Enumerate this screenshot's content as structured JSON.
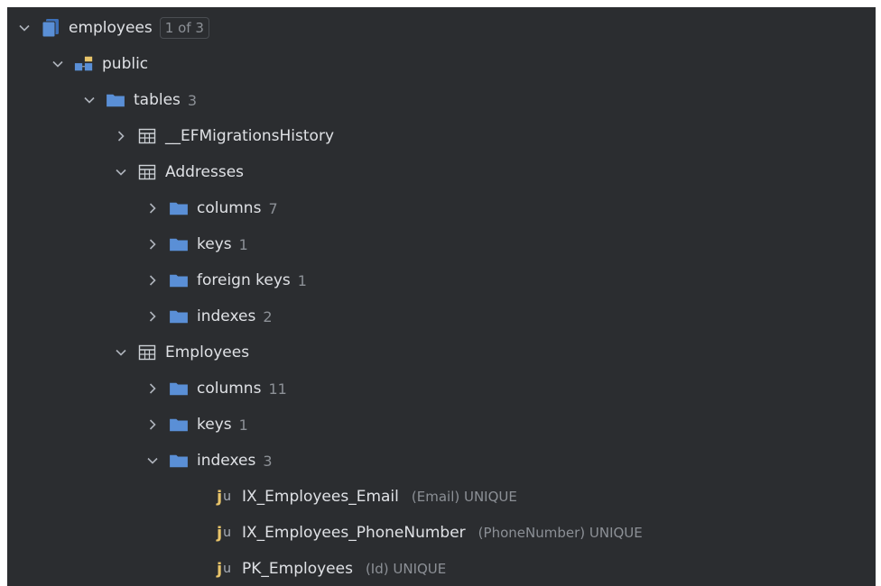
{
  "tree": {
    "root": {
      "label": "employees",
      "badge": "1 of 3"
    },
    "schema": {
      "label": "public"
    },
    "tables": {
      "label": "tables",
      "count": "3"
    },
    "t1": {
      "label": "__EFMigrationsHistory"
    },
    "t2": {
      "label": "Addresses",
      "columns": {
        "label": "columns",
        "count": "7"
      },
      "keys": {
        "label": "keys",
        "count": "1"
      },
      "fkeys": {
        "label": "foreign keys",
        "count": "1"
      },
      "indexes": {
        "label": "indexes",
        "count": "2"
      }
    },
    "t3": {
      "label": "Employees",
      "columns": {
        "label": "columns",
        "count": "11"
      },
      "keys": {
        "label": "keys",
        "count": "1"
      },
      "indexes": {
        "label": "indexes",
        "count": "3"
      },
      "idx": [
        {
          "name": "IX_Employees_Email",
          "detail": "(Email) UNIQUE"
        },
        {
          "name": "IX_Employees_PhoneNumber",
          "detail": "(PhoneNumber) UNIQUE"
        },
        {
          "name": "PK_Employees",
          "detail": "(Id) UNIQUE"
        }
      ]
    }
  },
  "colors": {
    "panel": "#2b2d30",
    "folder": "#5a8fd6",
    "text": "#dfe1e5",
    "muted": "#8c9096",
    "index": "#e8c46a"
  },
  "icons": [
    "chevron-down-icon",
    "chevron-right-icon",
    "database-icon",
    "schema-icon",
    "folder-icon",
    "table-icon",
    "index-icon"
  ]
}
